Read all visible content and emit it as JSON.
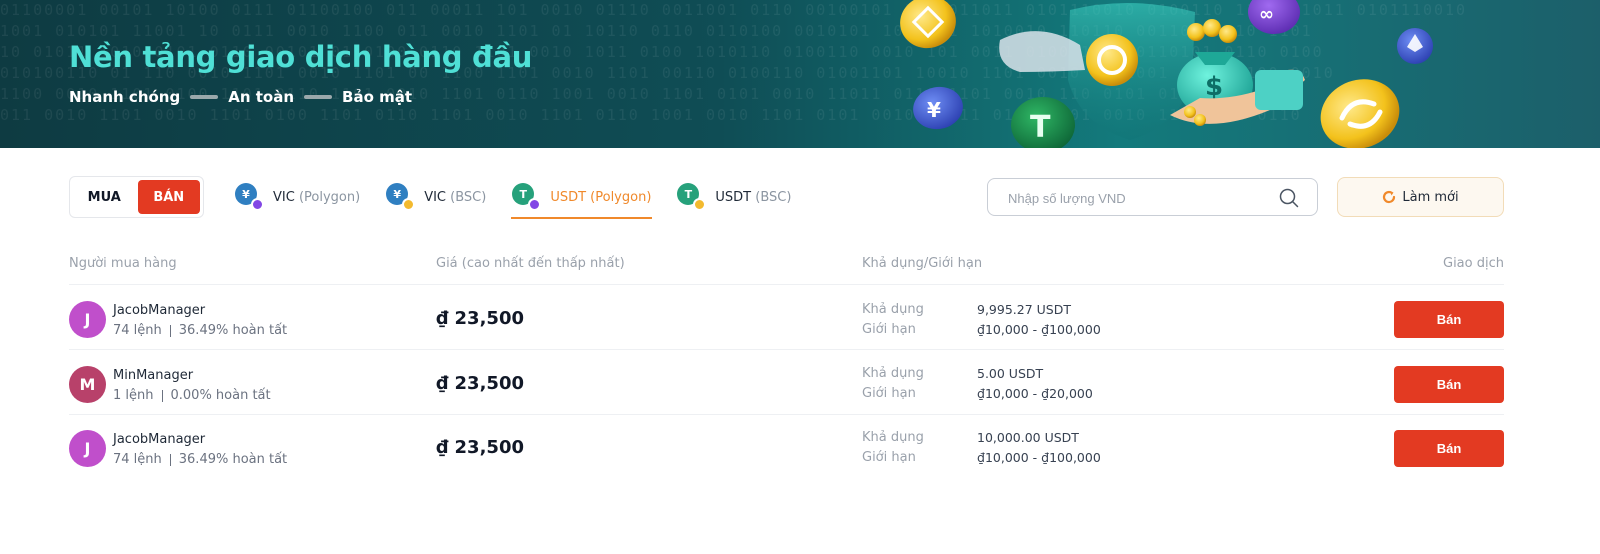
{
  "banner": {
    "title": "Nền tảng giao dịch hàng đầu",
    "tagline": [
      "Nhanh chóng",
      "An toàn",
      "Bảo mật"
    ]
  },
  "side_toggle": {
    "buy_label": "MUA",
    "sell_label": "BÁN",
    "active": "sell"
  },
  "tokens": [
    {
      "name": "VIC",
      "network": "(Polygon)",
      "icon": "vic-icon",
      "badge": "polygon-icon",
      "active": false
    },
    {
      "name": "VIC",
      "network": "(BSC)",
      "icon": "vic-icon",
      "badge": "bsc-icon",
      "active": false
    },
    {
      "name": "USDT",
      "network": "(Polygon)",
      "icon": "tether-icon",
      "badge": "polygon-icon",
      "active": true
    },
    {
      "name": "USDT",
      "network": "(BSC)",
      "icon": "tether-icon",
      "badge": "bsc-icon",
      "active": false
    }
  ],
  "search": {
    "placeholder": "Nhập số lượng VND",
    "value": ""
  },
  "refresh_label": "Làm mới",
  "table": {
    "headers": {
      "buyer": "Người mua hàng",
      "price": "Giá (cao nhất đến thấp nhất)",
      "available": "Khả dụng/Giới hạn",
      "action": "Giao dịch"
    },
    "rows": [
      {
        "initial": "J",
        "avatar_color": "#c04fcb",
        "name": "JacobManager",
        "orders": "74 lệnh",
        "completion": "36.49% hoàn tất",
        "currency": "₫",
        "price": "23,500",
        "available_label": "Khả dụng",
        "available": "9,995.27 USDT",
        "limit_label": "Giới hạn",
        "limit": "₫10,000 - ₫100,000",
        "action": "Bán"
      },
      {
        "initial": "M",
        "avatar_color": "#b8416a",
        "name": "MinManager",
        "orders": "1 lệnh",
        "completion": "0.00% hoàn tất",
        "currency": "₫",
        "price": "23,500",
        "available_label": "Khả dụng",
        "available": "5.00 USDT",
        "limit_label": "Giới hạn",
        "limit": "₫10,000 - ₫20,000",
        "action": "Bán"
      },
      {
        "initial": "J",
        "avatar_color": "#c04fcb",
        "name": "JacobManager",
        "orders": "74 lệnh",
        "completion": "36.49% hoàn tất",
        "currency": "₫",
        "price": "23,500",
        "available_label": "Khả dụng",
        "available": "10,000.00 USDT",
        "limit_label": "Giới hạn",
        "limit": "₫10,000 - ₫100,000",
        "action": "Bán"
      }
    ]
  },
  "colors": {
    "accent_orange": "#f0892b",
    "sell_red": "#e33a22",
    "banner_title": "#4fe0d6"
  }
}
